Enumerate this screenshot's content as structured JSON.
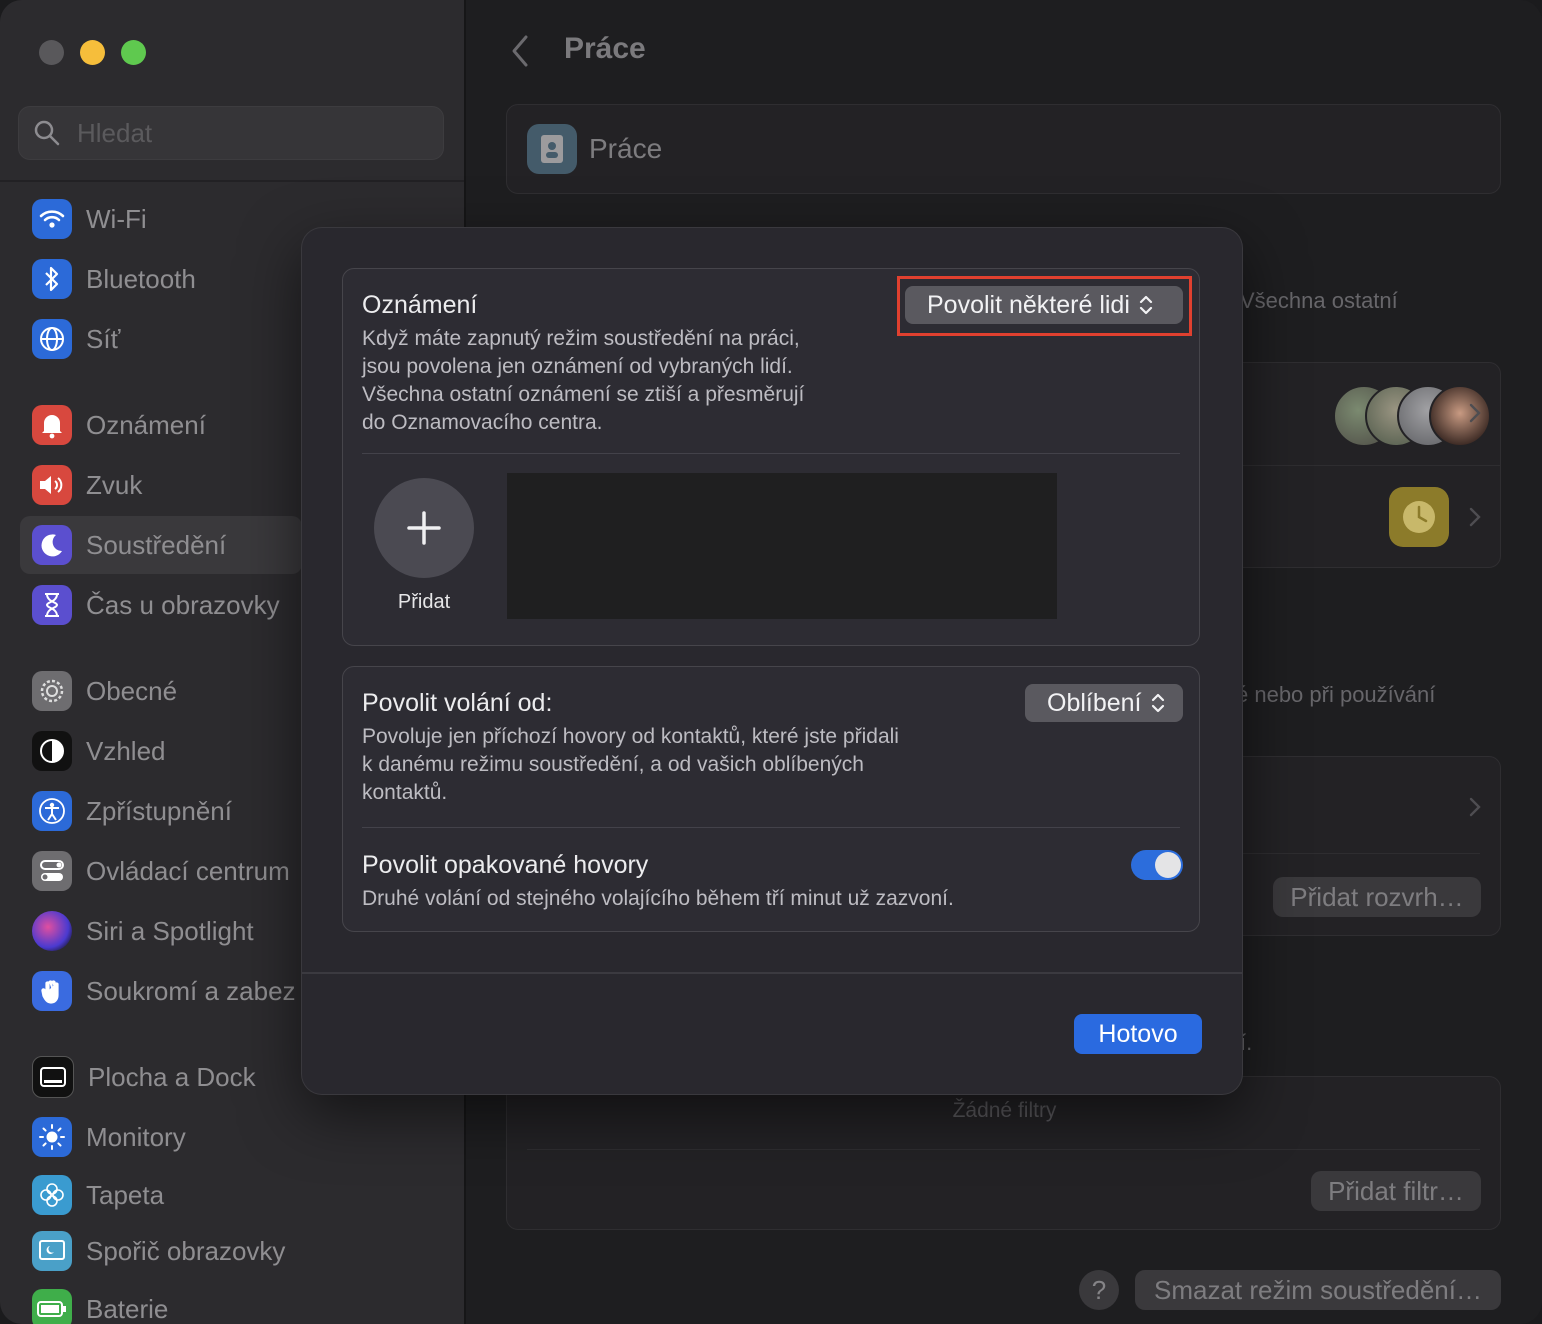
{
  "sidebar": {
    "search_placeholder": "Hledat",
    "items": [
      {
        "label": "Wi-Fi",
        "icon": "wifi-icon",
        "color": "#2c6ad8"
      },
      {
        "label": "Bluetooth",
        "icon": "bluetooth-icon",
        "color": "#2c6ad8"
      },
      {
        "label": "Síť",
        "icon": "globe-icon",
        "color": "#2c6ad8"
      },
      {
        "label": "Oznámení",
        "icon": "bell-icon",
        "color": "#d8483e"
      },
      {
        "label": "Zvuk",
        "icon": "speaker-icon",
        "color": "#d8483e"
      },
      {
        "label": "Soustředění",
        "icon": "moon-icon",
        "color": "#5b4fcf"
      },
      {
        "label": "Čas u obrazovky",
        "icon": "hourglass-icon",
        "color": "#5b4fcf"
      },
      {
        "label": "Obecné",
        "icon": "gear-icon",
        "color": "#6e6d70"
      },
      {
        "label": "Vzhled",
        "icon": "appearance-icon",
        "color": "#1a1a1a"
      },
      {
        "label": "Zpřístupnění",
        "icon": "accessibility-icon",
        "color": "#2c6ad8"
      },
      {
        "label": "Ovládací centrum",
        "icon": "control-center-icon",
        "color": "#6e6d70"
      },
      {
        "label": "Siri a Spotlight",
        "icon": "siri-icon",
        "color": "#8a3cc7"
      },
      {
        "label": "Soukromí a zabez",
        "icon": "hand-icon",
        "color": "#3a6be0"
      },
      {
        "label": "Plocha a Dock",
        "icon": "dock-icon",
        "color": "#1a1a1a"
      },
      {
        "label": "Monitory",
        "icon": "sun-icon",
        "color": "#2c6ad8"
      },
      {
        "label": "Tapeta",
        "icon": "flower-icon",
        "color": "#3a9bd0"
      },
      {
        "label": "Spořič obrazovky",
        "icon": "screensaver-icon",
        "color": "#4aa0c8"
      },
      {
        "label": "Baterie",
        "icon": "battery-icon",
        "color": "#3fae4a"
      }
    ],
    "active_item": "Soustředění"
  },
  "main": {
    "title": "Práce",
    "focus_name": "Práce",
    "bg_text_1": "Všechna ostatní",
    "bg_text_2": "é nebo při používání",
    "bg_text_3": "í.",
    "add_schedule_label": "Přidat rozvrh…",
    "no_filters_label": "Žádné filtry",
    "add_filter_label": "Přidat filtr…",
    "delete_focus_label": "Smazat režim soustředění…",
    "help_label": "?"
  },
  "modal": {
    "notifications": {
      "title": "Oznámení",
      "popup_value": "Povolit některé lidi",
      "description": [
        "Když máte zapnutý režim soustředění na práci,",
        "jsou povolena jen oznámení od vybraných lidí.",
        "Všechna ostatní oznámení se ztiší a přesměrují",
        "do Oznamovacího centra."
      ],
      "add_label": "Přidat"
    },
    "calls": {
      "title": "Povolit volání od:",
      "popup_value": "Oblíbení",
      "description": [
        "Povoluje jen příchozí hovory od kontaktů, které jste přidali",
        "k danému režimu soustředění, a od vašich oblíbených",
        "kontaktů."
      ]
    },
    "repeated_calls": {
      "title": "Povolit opakované hovory",
      "description": "Druhé volání od stejného volajícího během tří minut už zazvoní.",
      "enabled": true
    },
    "done_label": "Hotovo"
  },
  "colors": {
    "accent": "#2a6ae0",
    "highlight_box": "#e0402f"
  }
}
